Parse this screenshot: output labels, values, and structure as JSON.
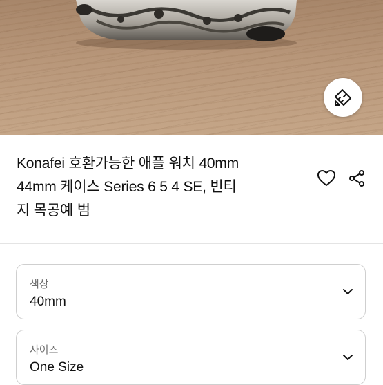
{
  "product": {
    "title_lines": [
      "Konafei 호환가능한 애플 워치 40mm",
      "44mm 케이스 Series 6 5 4 SE, 빈티",
      "지 목공예 범"
    ]
  },
  "options": {
    "color": {
      "label": "색상",
      "value": "40mm"
    },
    "size": {
      "label": "사이즈",
      "value": "One Size"
    }
  },
  "icons": {
    "size_guide": "ruler-icon",
    "wishlist": "heart-icon",
    "share": "share-icon",
    "dropdown": "chevron-down-icon"
  },
  "colors": {
    "border": "#cfcfcf",
    "label": "#6f6f6f",
    "text": "#111111"
  }
}
